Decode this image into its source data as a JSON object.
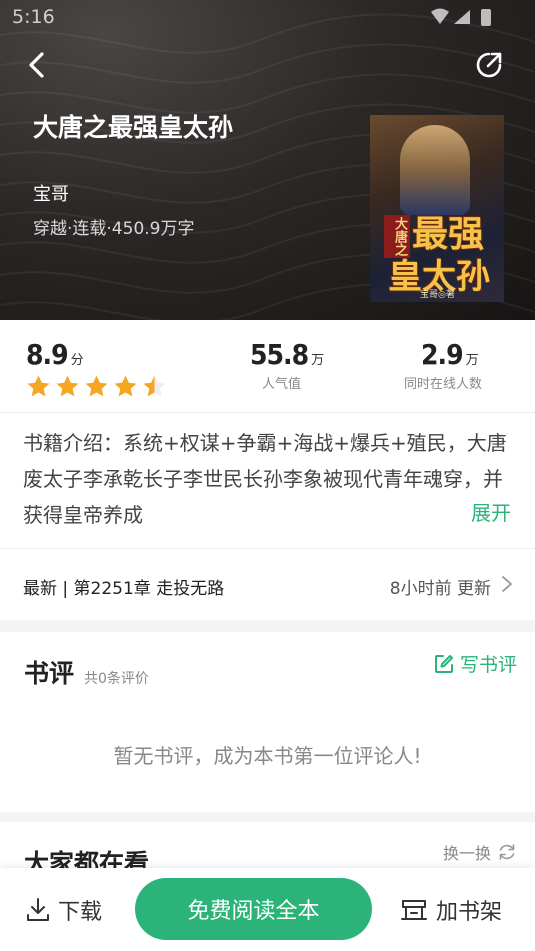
{
  "status": {
    "time": "5:16"
  },
  "book": {
    "title": "大唐之最强皇太孙",
    "author": "宝哥",
    "meta": "穿越·连载·450.9万字",
    "cover": {
      "tag": "大唐之",
      "title_line1": "最强",
      "title_line2": "皇太孙",
      "author": "宝哥◎著"
    }
  },
  "stats": {
    "rating": {
      "value": "8.9",
      "unit": "分",
      "stars": 4.5
    },
    "popularity": {
      "value": "55.8",
      "unit": "万",
      "label": "人气值"
    },
    "online": {
      "value": "2.9",
      "unit": "万",
      "label": "同时在线人数"
    }
  },
  "intro": {
    "text": "书籍介绍：系统+权谋+争霸+海战+爆兵+殖民，大唐废太子李承乾长子李世民长孙李象被现代青年魂穿，并获得皇帝养成",
    "expand_label": "展开"
  },
  "latest": {
    "chapter": "最新 | 第2251章 走投无路",
    "updated": "8小时前 更新"
  },
  "reviews": {
    "title": "书评",
    "count": "共0条评价",
    "write_label": "写书评",
    "empty_text": "暂无书评，成为本书第一位评论人!"
  },
  "recommend": {
    "title": "大家都在看",
    "refresh_label": "换一换"
  },
  "bottom": {
    "download_label": "下载",
    "read_label": "免费阅读全本",
    "shelf_label": "加书架"
  },
  "colors": {
    "accent": "#2bb37a",
    "star": "#f5a623"
  }
}
